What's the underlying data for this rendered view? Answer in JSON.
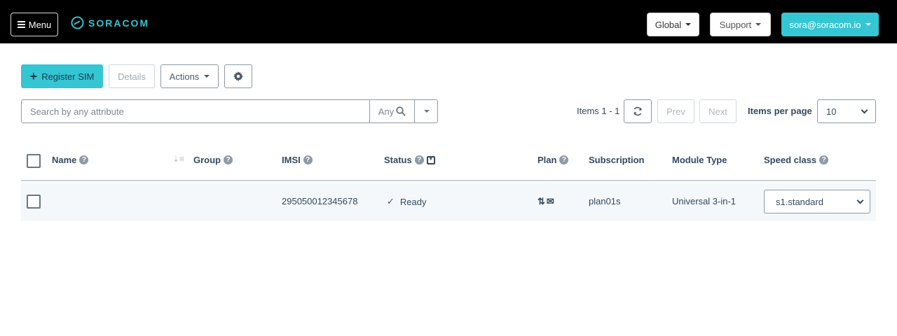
{
  "header": {
    "menu_label": "Menu",
    "logo_text": "SORACOM",
    "global_label": "Global",
    "support_label": "Support",
    "user_label": "sora@soracom.io",
    "colors": {
      "bar": "#000000",
      "brand": "#34c6d3"
    }
  },
  "toolbar": {
    "register_label": "Register SIM",
    "details_label": "Details",
    "actions_label": "Actions",
    "settings_icon": "gear-icon"
  },
  "search": {
    "placeholder": "Search by attribute",
    "placeholder_full": "Search by any attribute",
    "scope_label": "Any"
  },
  "pagination": {
    "items_label": "Items 1 - 1",
    "prev_label": "Prev",
    "next_label": "Next",
    "per_page_label": "Items per page",
    "per_page_value": "10"
  },
  "table": {
    "columns": {
      "name": "Name",
      "group": "Group",
      "imsi": "IMSI",
      "status": "Status",
      "plan": "Plan",
      "subscription": "Subscription",
      "module_type": "Module Type",
      "speed_class": "Speed class"
    },
    "rows": [
      {
        "name": "",
        "group": "",
        "imsi": "295050012345678",
        "status": "Ready",
        "plan_icons": [
          "data-transfer-icon",
          "sms-envelope-icon"
        ],
        "subscription": "plan01s",
        "module_type": "Universal 3-in-1",
        "speed_class": "s1.standard"
      }
    ]
  }
}
